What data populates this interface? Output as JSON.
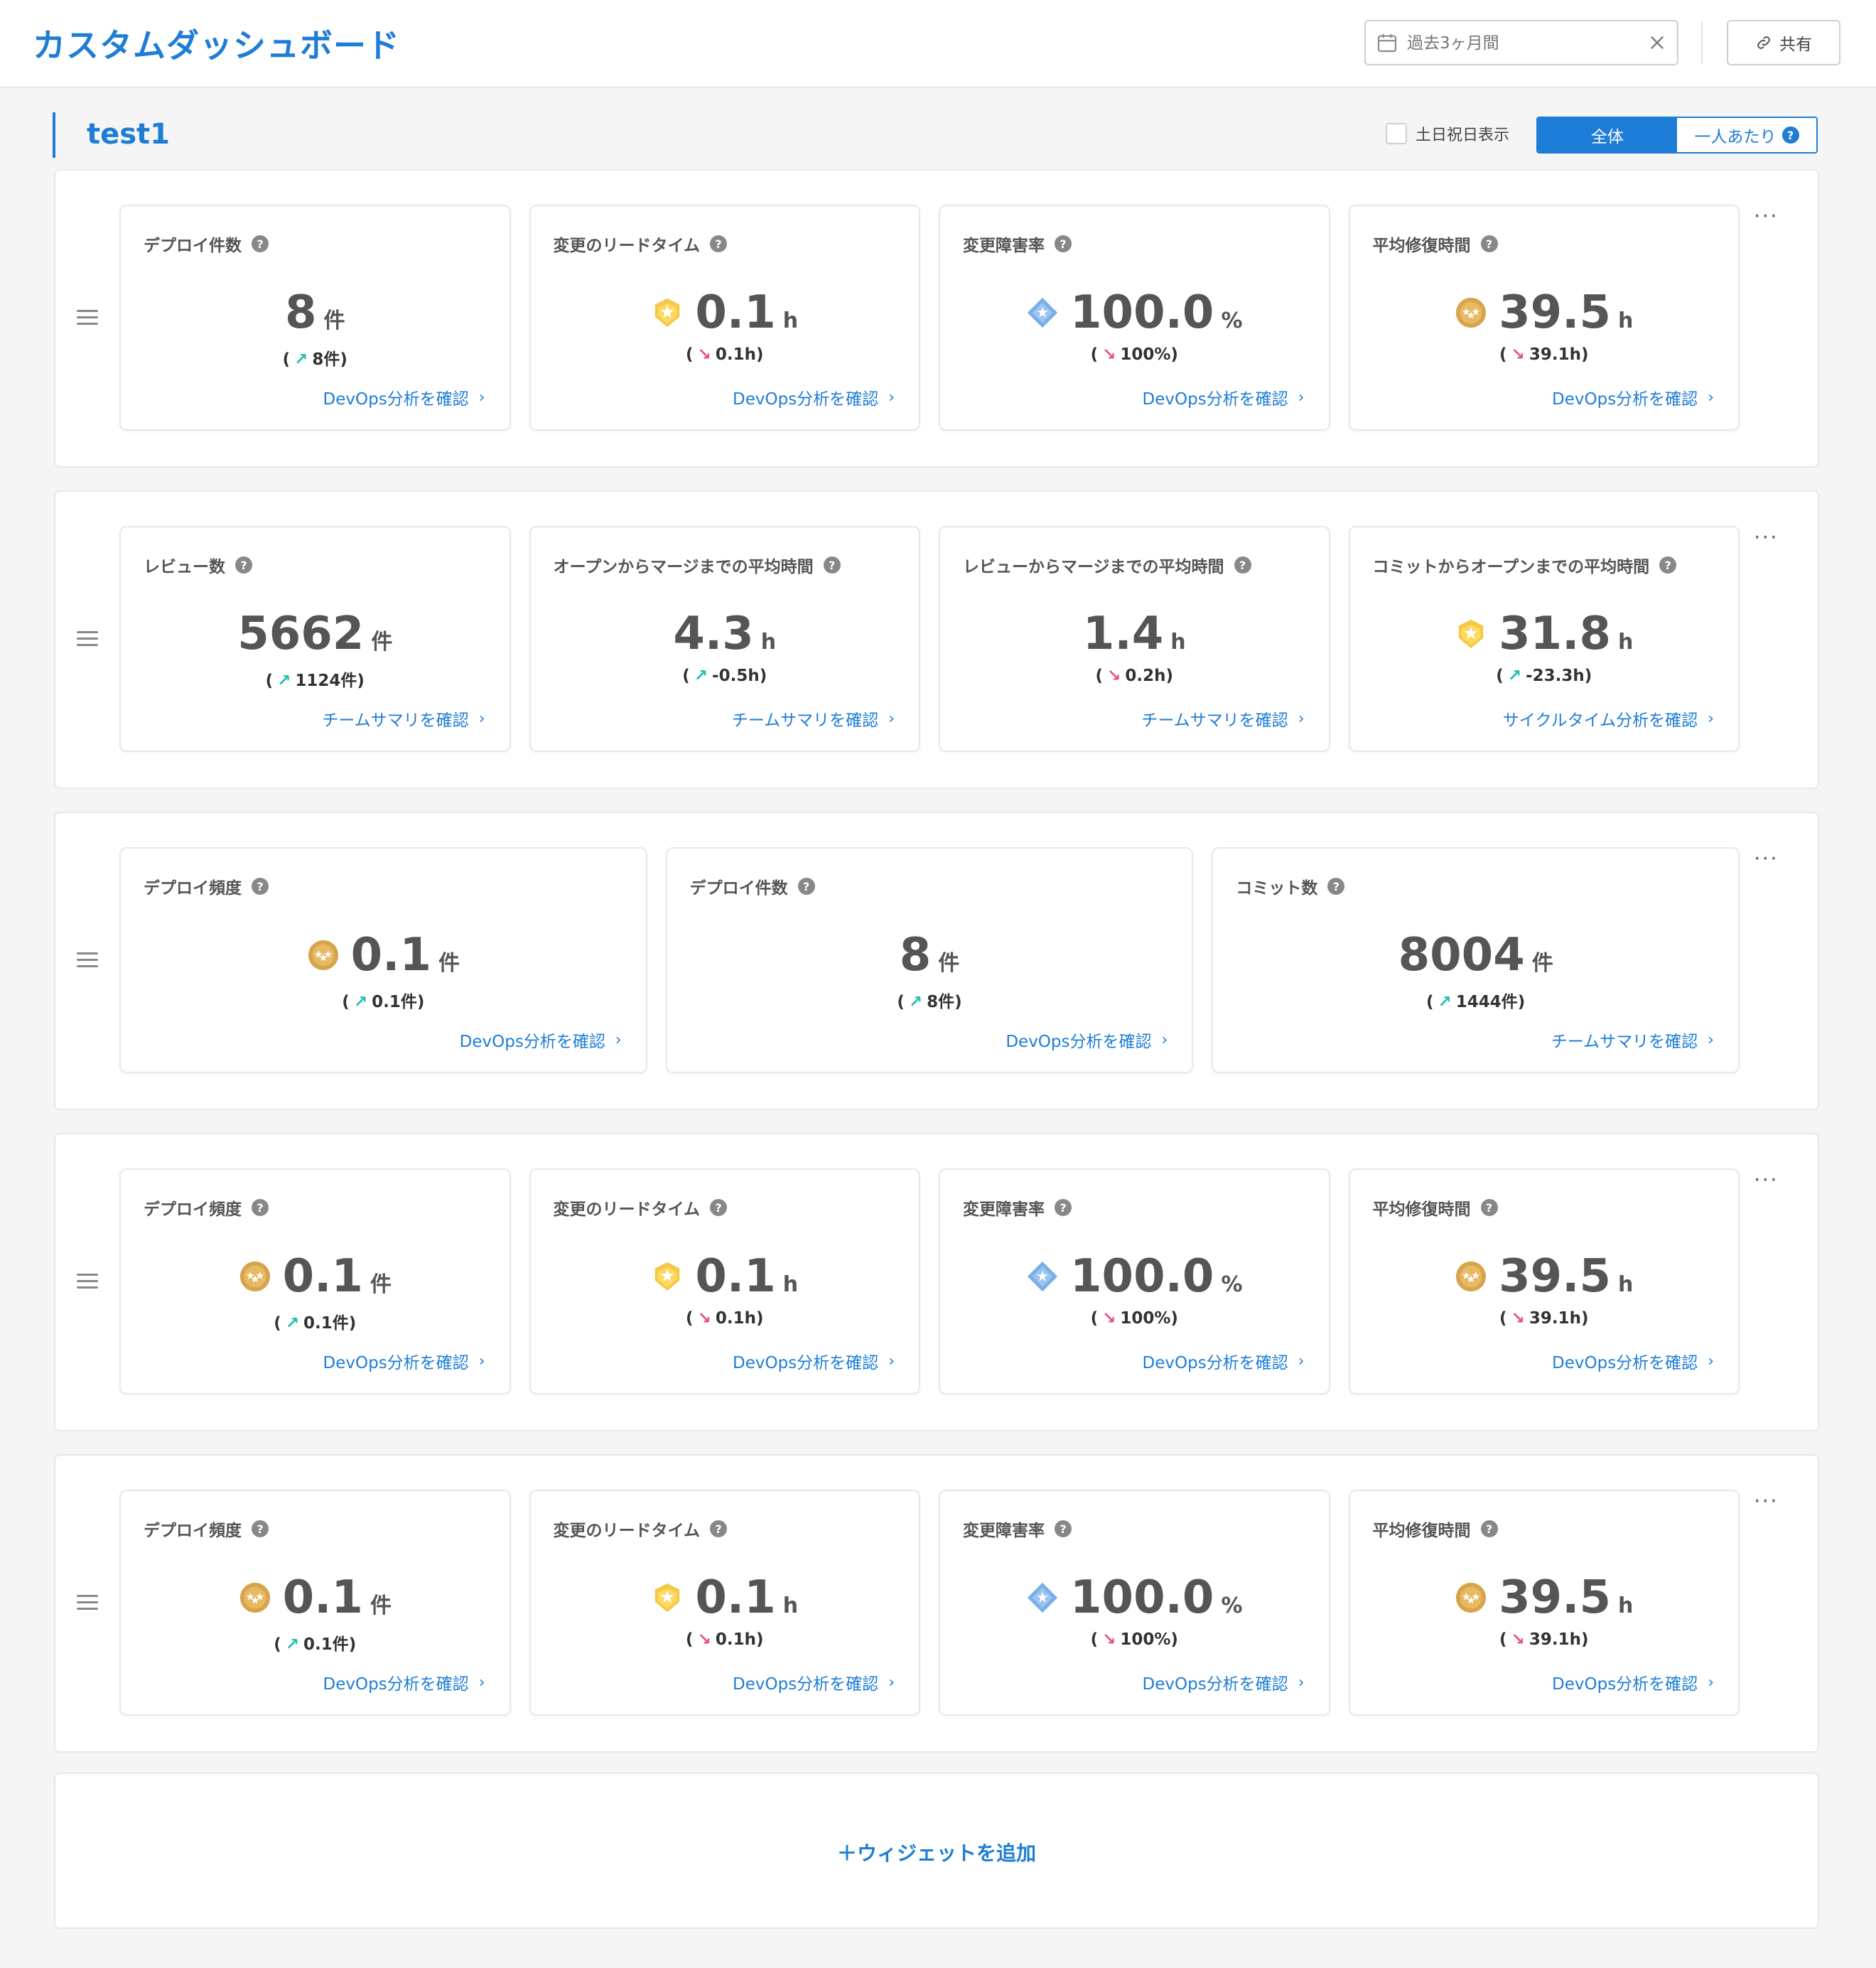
{
  "header": {
    "title": "カスタムダッシュボード",
    "date_placeholder": "過去3ヶ月間",
    "share_label": "共有"
  },
  "section": {
    "title": "test1",
    "holiday_label": "土日祝日表示",
    "seg_all": "全体",
    "seg_per_person": "一人あたり"
  },
  "colors": {
    "accent": "#1e7dd6",
    "up": "#1fbfb3",
    "down": "#ea4c89"
  },
  "widgets": [
    {
      "cards": [
        {
          "title": "デプロイ件数",
          "value": "8",
          "unit": "件",
          "badge": "",
          "delta_arrow": "↗",
          "delta_dir": "up",
          "delta": "8件)",
          "link": "DevOps分析を確認"
        },
        {
          "title": "変更のリードタイム",
          "value": "0.1",
          "unit": "h",
          "badge": "shield-gold",
          "delta_arrow": "↘",
          "delta_dir": "down",
          "delta": "0.1h)",
          "link": "DevOps分析を確認"
        },
        {
          "title": "変更障害率",
          "value": "100.0",
          "unit": "%",
          "badge": "diamond-blue",
          "delta_arrow": "↘",
          "delta_dir": "down",
          "delta": "100%)",
          "link": "DevOps分析を確認"
        },
        {
          "title": "平均修復時間",
          "value": "39.5",
          "unit": "h",
          "badge": "circle-bronze",
          "delta_arrow": "↘",
          "delta_dir": "down",
          "delta": "39.1h)",
          "link": "DevOps分析を確認"
        }
      ]
    },
    {
      "cards": [
        {
          "title": "レビュー数",
          "value": "5662",
          "unit": "件",
          "badge": "",
          "delta_arrow": "↗",
          "delta_dir": "up",
          "delta": "1124件)",
          "link": "チームサマリを確認"
        },
        {
          "title": "オープンからマージまでの平均時間",
          "value": "4.3",
          "unit": "h",
          "badge": "",
          "delta_arrow": "↗",
          "delta_dir": "up",
          "delta": "-0.5h)",
          "link": "チームサマリを確認"
        },
        {
          "title": "レビューからマージまでの平均時間",
          "value": "1.4",
          "unit": "h",
          "badge": "",
          "delta_arrow": "↘",
          "delta_dir": "down",
          "delta": "0.2h)",
          "link": "チームサマリを確認"
        },
        {
          "title": "コミットからオープンまでの平均時間",
          "value": "31.8",
          "unit": "h",
          "badge": "shield-gold",
          "delta_arrow": "↗",
          "delta_dir": "up",
          "delta": "-23.3h)",
          "link": "サイクルタイム分析を確認"
        }
      ]
    },
    {
      "cards": [
        {
          "title": "デプロイ頻度",
          "value": "0.1",
          "unit": "件",
          "badge": "circle-bronze",
          "delta_arrow": "↗",
          "delta_dir": "up",
          "delta": "0.1件)",
          "link": "DevOps分析を確認"
        },
        {
          "title": "デプロイ件数",
          "value": "8",
          "unit": "件",
          "badge": "",
          "delta_arrow": "↗",
          "delta_dir": "up",
          "delta": "8件)",
          "link": "DevOps分析を確認"
        },
        {
          "title": "コミット数",
          "value": "8004",
          "unit": "件",
          "badge": "",
          "delta_arrow": "↗",
          "delta_dir": "up",
          "delta": "1444件)",
          "link": "チームサマリを確認"
        }
      ]
    },
    {
      "cards": [
        {
          "title": "デプロイ頻度",
          "value": "0.1",
          "unit": "件",
          "badge": "circle-bronze",
          "delta_arrow": "↗",
          "delta_dir": "up",
          "delta": "0.1件)",
          "link": "DevOps分析を確認"
        },
        {
          "title": "変更のリードタイム",
          "value": "0.1",
          "unit": "h",
          "badge": "shield-gold",
          "delta_arrow": "↘",
          "delta_dir": "down",
          "delta": "0.1h)",
          "link": "DevOps分析を確認"
        },
        {
          "title": "変更障害率",
          "value": "100.0",
          "unit": "%",
          "badge": "diamond-blue",
          "delta_arrow": "↘",
          "delta_dir": "down",
          "delta": "100%)",
          "link": "DevOps分析を確認"
        },
        {
          "title": "平均修復時間",
          "value": "39.5",
          "unit": "h",
          "badge": "circle-bronze",
          "delta_arrow": "↘",
          "delta_dir": "down",
          "delta": "39.1h)",
          "link": "DevOps分析を確認"
        }
      ]
    },
    {
      "cards": [
        {
          "title": "デプロイ頻度",
          "value": "0.1",
          "unit": "件",
          "badge": "circle-bronze",
          "delta_arrow": "↗",
          "delta_dir": "up",
          "delta": "0.1件)",
          "link": "DevOps分析を確認"
        },
        {
          "title": "変更のリードタイム",
          "value": "0.1",
          "unit": "h",
          "badge": "shield-gold",
          "delta_arrow": "↘",
          "delta_dir": "down",
          "delta": "0.1h)",
          "link": "DevOps分析を確認"
        },
        {
          "title": "変更障害率",
          "value": "100.0",
          "unit": "%",
          "badge": "diamond-blue",
          "delta_arrow": "↘",
          "delta_dir": "down",
          "delta": "100%)",
          "link": "DevOps分析を確認"
        },
        {
          "title": "平均修復時間",
          "value": "39.5",
          "unit": "h",
          "badge": "circle-bronze",
          "delta_arrow": "↘",
          "delta_dir": "down",
          "delta": "39.1h)",
          "link": "DevOps分析を確認"
        }
      ]
    }
  ],
  "add_widget_label": "＋ウィジェットを追加"
}
